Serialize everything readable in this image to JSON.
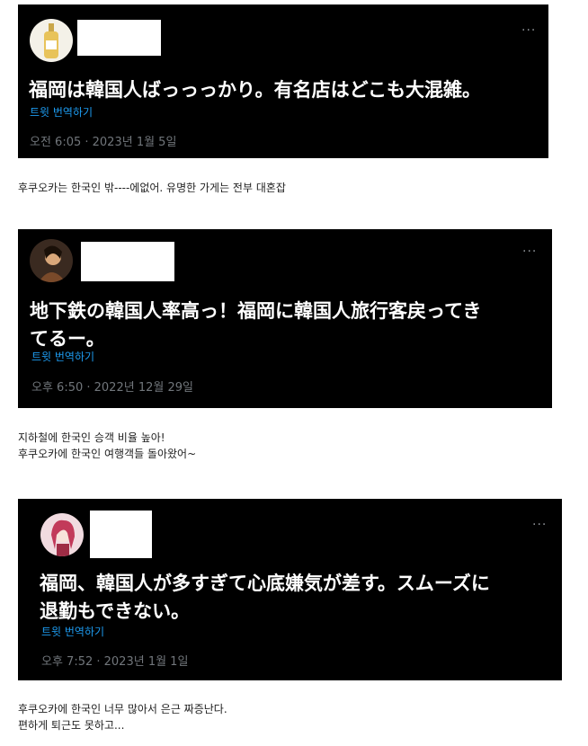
{
  "tweets": [
    {
      "more": "···",
      "text": "福岡は韓国人ばっっっかり。有名店はどこも大混雑。",
      "translate": "트윗 번역하기",
      "timestamp": "오전 6:05 · 2023년 1월 5일",
      "caption": "후쿠오카는 한국인 밖----에없어. 유명한 가게는 전부 대혼잡"
    },
    {
      "more": "···",
      "text": "地下鉄の韓国人率高っ！福岡に韓国人旅行客戻ってき\nてるー。",
      "translate": "트윗 번역하기",
      "timestamp": "오후 6:50 · 2022년 12월 29일",
      "caption": "지하철에 한국인 승객 비율 높아!\n후쿠오카에 한국인 여행객들 돌아왔어~"
    },
    {
      "more": "···",
      "text": "福岡、韓国人が多すぎて心底嫌気が差す。スムーズに\n退勤もできない。",
      "translate": "트윗 번역하기",
      "timestamp": "오후 7:52 · 2023년 1월 1일",
      "caption": "후쿠오카에 한국인 너무 많아서 은근 짜증난다.\n편하게 퇴근도 못하고..."
    }
  ],
  "colors": {
    "card_bg": "#000000",
    "tweet_text": "#ffffff",
    "translate_link": "#1d9bf0",
    "timestamp": "#71767b"
  }
}
